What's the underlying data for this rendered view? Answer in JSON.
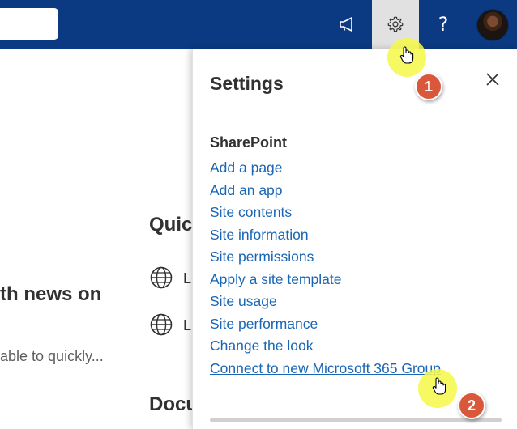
{
  "page": {
    "news_heading": "th news on",
    "news_sub": "able to quickly...",
    "quick_links_heading": "Quic",
    "link1_partial": "L",
    "link2_partial": "L",
    "documents_heading": "Docu"
  },
  "topbar": {
    "icons": [
      "megaphone-icon",
      "gear-icon",
      "help-icon",
      "avatar"
    ],
    "help_label": "?"
  },
  "settings": {
    "title": "Settings",
    "section": "SharePoint",
    "items": [
      "Add a page",
      "Add an app",
      "Site contents",
      "Site information",
      "Site permissions",
      "Apply a site template",
      "Site usage",
      "Site performance",
      "Change the look",
      "Connect to new Microsoft 365 Group"
    ]
  },
  "annotations": {
    "step1": "1",
    "step2": "2",
    "halo_color": "#f5f846",
    "badge_color": "#d9573a"
  },
  "colors": {
    "suite_bar": "#0b3a82",
    "link": "#1a66b5"
  }
}
